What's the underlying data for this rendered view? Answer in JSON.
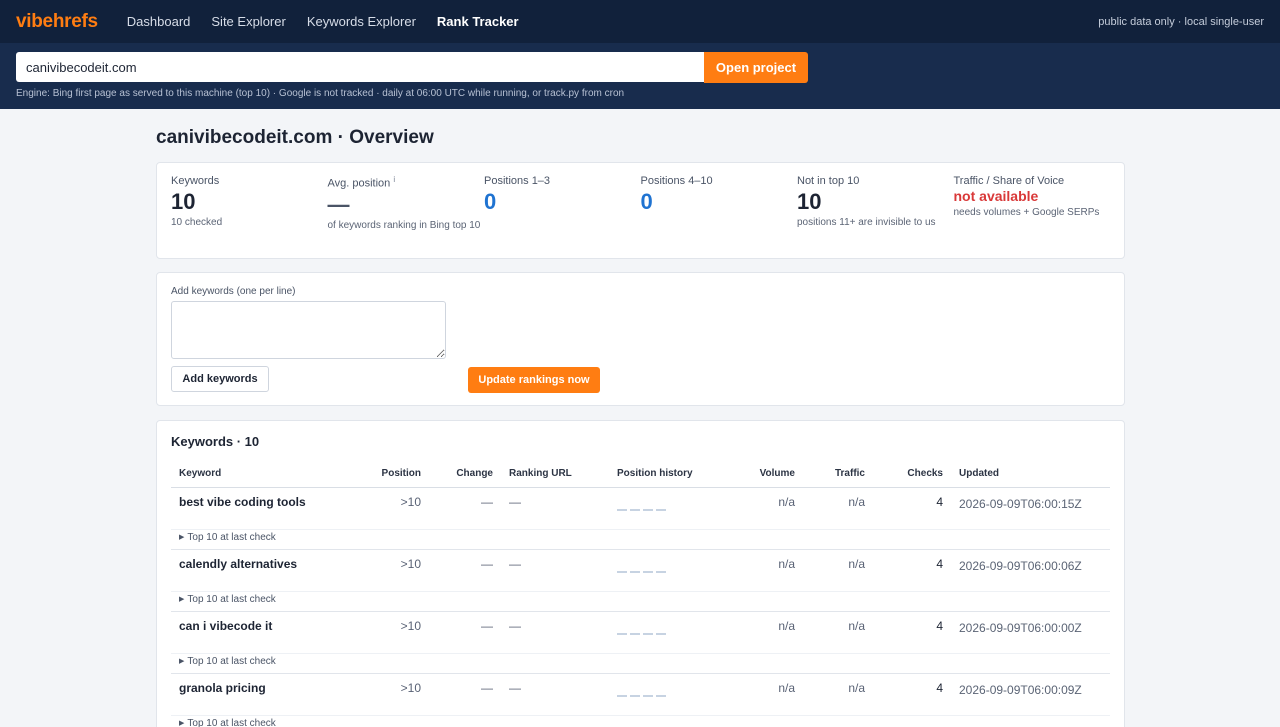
{
  "nav": {
    "logo": "vibehrefs",
    "items": [
      "Dashboard",
      "Site Explorer",
      "Keywords Explorer",
      "Rank Tracker"
    ],
    "right_note": "public data only · local single-user"
  },
  "search": {
    "value": "canivibecodeit.com",
    "button": "Open project",
    "engine_note": "Engine: Bing first page as served to this machine (top 10) · Google is not tracked · daily at 06:00 UTC while running, or track.py from cron"
  },
  "page_title": "canivibecodeit.com · Overview",
  "stats": [
    {
      "label": "Keywords",
      "value": "10",
      "sub": "10 checked",
      "style": "",
      "info": ""
    },
    {
      "label": "Avg. position",
      "value": "—",
      "sub": "of keywords ranking in Bing top 10",
      "style": "dash",
      "info": "i"
    },
    {
      "label": "Positions 1–3",
      "value": "0",
      "sub": "",
      "style": "blue",
      "info": ""
    },
    {
      "label": "Positions 4–10",
      "value": "0",
      "sub": "",
      "style": "blue",
      "info": ""
    },
    {
      "label": "Not in top 10",
      "value": "10",
      "sub": "positions 11+ are invisible to us",
      "style": "",
      "info": ""
    },
    {
      "label": "Traffic / Share of Voice",
      "value": "not available",
      "sub": "needs volumes + Google SERPs",
      "style": "red",
      "info": ""
    }
  ],
  "add": {
    "label": "Add keywords (one per line)",
    "textarea_value": "",
    "add_button": "Add keywords",
    "update_button": "Update rankings now"
  },
  "keywords": {
    "title": "Keywords · 10",
    "columns": [
      "Keyword",
      "Position",
      "Change",
      "Ranking URL",
      "Position history",
      "Volume",
      "Traffic",
      "Checks",
      "Updated"
    ],
    "detail_label": "Top 10 at last check",
    "rows": [
      {
        "keyword": "best vibe coding tools",
        "position": ">10",
        "change": "—",
        "url": "—",
        "volume": "n/a",
        "traffic": "n/a",
        "checks": "4",
        "updated": "2026-09-09T06:00:15Z"
      },
      {
        "keyword": "calendly alternatives",
        "position": ">10",
        "change": "—",
        "url": "—",
        "volume": "n/a",
        "traffic": "n/a",
        "checks": "4",
        "updated": "2026-09-09T06:00:06Z"
      },
      {
        "keyword": "can i vibecode it",
        "position": ">10",
        "change": "—",
        "url": "—",
        "volume": "n/a",
        "traffic": "n/a",
        "checks": "4",
        "updated": "2026-09-09T06:00:00Z"
      },
      {
        "keyword": "granola pricing",
        "position": ">10",
        "change": "—",
        "url": "—",
        "volume": "n/a",
        "traffic": "n/a",
        "checks": "4",
        "updated": "2026-09-09T06:00:09Z"
      }
    ]
  },
  "colors": {
    "accent": "#ff7d12",
    "nav_bg": "#11213b",
    "blue": "#1f73d1",
    "red": "#d93838"
  }
}
